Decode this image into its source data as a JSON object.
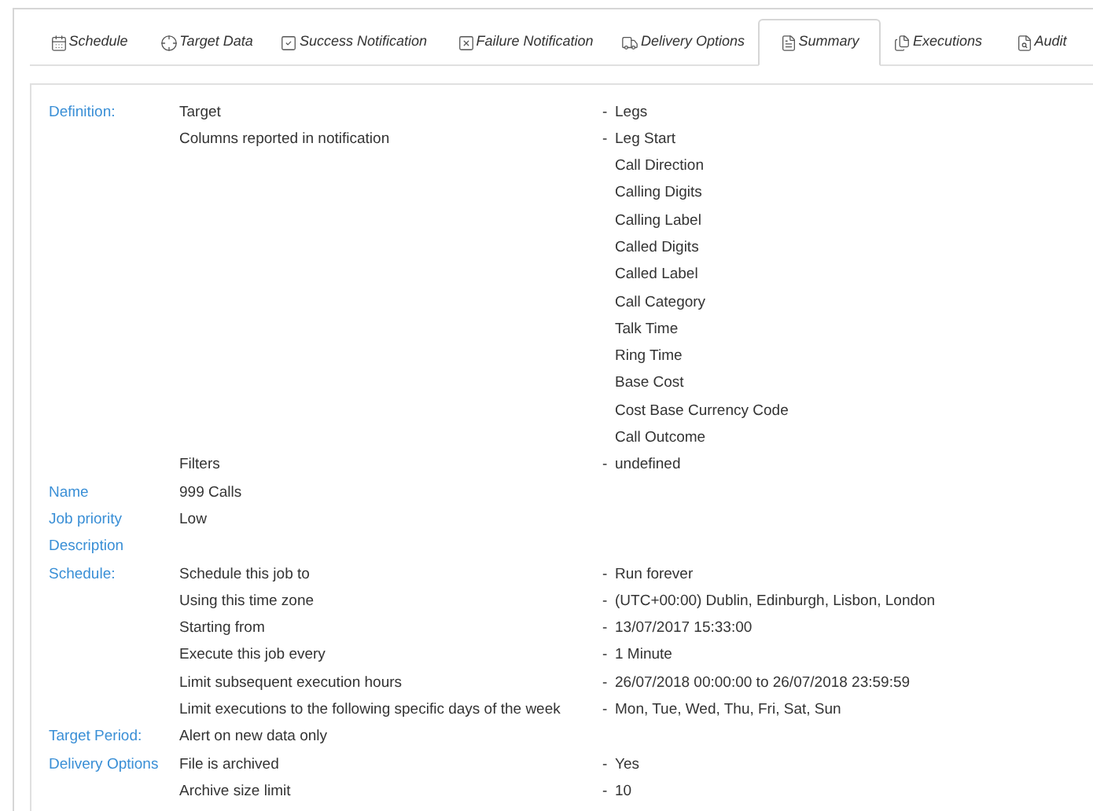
{
  "tabs": [
    {
      "label": "Schedule",
      "selected": false
    },
    {
      "label": "Target Data",
      "selected": false
    },
    {
      "label": "Success Notification",
      "selected": false
    },
    {
      "label": "Failure Notification",
      "selected": false
    },
    {
      "label": "Delivery Options",
      "selected": false
    },
    {
      "label": "Summary",
      "selected": true
    },
    {
      "label": "Executions",
      "selected": false
    },
    {
      "label": "Audit",
      "selected": false
    }
  ],
  "rows": [
    {
      "section": "Definition:",
      "item": "Target",
      "marker": "-",
      "value": "Legs"
    },
    {
      "item": "Columns reported in notification",
      "marker": "-",
      "value": "Leg Start"
    },
    {
      "value": "Call Direction"
    },
    {
      "value": "Calling Digits"
    },
    {
      "value": "Calling Label"
    },
    {
      "value": "Called Digits"
    },
    {
      "value": "Called Label"
    },
    {
      "value": "Call Category"
    },
    {
      "value": "Talk Time"
    },
    {
      "value": "Ring Time"
    },
    {
      "value": "Base Cost"
    },
    {
      "value": "Cost Base Currency Code"
    },
    {
      "value": "Call Outcome"
    },
    {
      "item": "Filters",
      "marker": "-",
      "value": "undefined"
    },
    {
      "section": "Name",
      "item": "999 Calls"
    },
    {
      "section": "Job priority",
      "item": "Low"
    },
    {
      "section": "Description"
    },
    {
      "section": "Schedule:",
      "item": "Schedule this job to",
      "marker": "-",
      "value": "Run forever"
    },
    {
      "item": "Using this time zone",
      "marker": "-",
      "value": "(UTC+00:00) Dublin, Edinburgh, Lisbon, London"
    },
    {
      "item": "Starting from",
      "marker": "-",
      "value": "13/07/2017 15:33:00"
    },
    {
      "item": "Execute this job every",
      "marker": "-",
      "value": "1 Minute"
    },
    {
      "item": "Limit subsequent execution hours",
      "marker": "-",
      "value": "26/07/2018 00:00:00 to 26/07/2018 23:59:59"
    },
    {
      "item": "Limit executions to the following specific days of the week",
      "marker": "-",
      "value": "Mon, Tue, Wed, Thu, Fri, Sat, Sun"
    },
    {
      "section": "Target Period:",
      "item": "Alert on new data only"
    },
    {
      "section": "Delivery Options",
      "item": "File is archived",
      "marker": "-",
      "value": "Yes"
    },
    {
      "item": "Archive size limit",
      "marker": "-",
      "value": "10"
    }
  ]
}
